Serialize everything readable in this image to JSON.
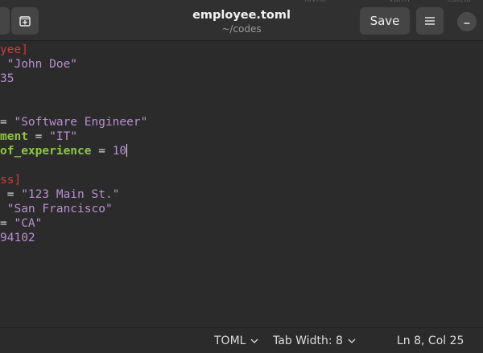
{
  "window": {
    "title": "employee.toml",
    "subtitle": "~/codes",
    "save_label": "Save",
    "background_tabs": [
      "lovno",
      "varm",
      "calcul"
    ]
  },
  "editor": {
    "lines": [
      {
        "tokens": [
          {
            "t": "yee]",
            "c": "section"
          }
        ]
      },
      {
        "tokens": [
          {
            "t": " \"John Doe\"",
            "c": "str"
          }
        ]
      },
      {
        "tokens": [
          {
            "t": "35",
            "c": "num"
          }
        ]
      },
      {
        "tokens": []
      },
      {
        "tokens": []
      },
      {
        "tokens": [
          {
            "t": "= ",
            "c": "op"
          },
          {
            "t": "\"Software Engineer\"",
            "c": "str"
          }
        ]
      },
      {
        "tokens": [
          {
            "t": "ment",
            "c": "key"
          },
          {
            "t": " = ",
            "c": "op"
          },
          {
            "t": "\"IT\"",
            "c": "str"
          }
        ]
      },
      {
        "tokens": [
          {
            "t": "of_experience",
            "c": "key"
          },
          {
            "t": " = ",
            "c": "op"
          },
          {
            "t": "10",
            "c": "num"
          }
        ],
        "cursor": true
      },
      {
        "tokens": []
      },
      {
        "tokens": [
          {
            "t": "ss]",
            "c": "section"
          }
        ]
      },
      {
        "tokens": [
          {
            "t": " = ",
            "c": "op"
          },
          {
            "t": "\"123 Main St.\"",
            "c": "str"
          }
        ]
      },
      {
        "tokens": [
          {
            "t": " ",
            "c": "op"
          },
          {
            "t": "\"San Francisco\"",
            "c": "str"
          }
        ]
      },
      {
        "tokens": [
          {
            "t": "= ",
            "c": "op"
          },
          {
            "t": "\"CA\"",
            "c": "str"
          }
        ]
      },
      {
        "tokens": [
          {
            "t": "94102",
            "c": "num"
          }
        ]
      }
    ]
  },
  "statusbar": {
    "language": "TOML",
    "tab_width": "Tab Width: 8",
    "position": "Ln 8, Col 25"
  },
  "colors": {
    "section": "#d13b3b",
    "key": "#8ec44a",
    "string": "#b98fd1",
    "background": "#2b2b2b"
  }
}
